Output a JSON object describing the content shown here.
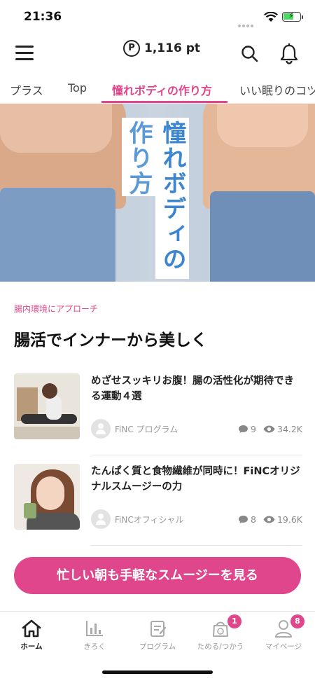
{
  "status_bar": {
    "time": "21:36"
  },
  "header": {
    "points_icon": "P",
    "points": "1,116 pt",
    "icons": [
      "menu-icon",
      "search-icon",
      "bell-icon"
    ]
  },
  "tabs": [
    {
      "label": "プラス"
    },
    {
      "label": "Top"
    },
    {
      "label": "憧れボディの作り方",
      "active": true
    },
    {
      "label": "いい眠りのコツ"
    }
  ],
  "hero": {
    "title_line1": "作り方",
    "title_line2": "憧れボディの"
  },
  "section": {
    "category": "腸内環境にアプローチ",
    "title": "腸活でインナーから美しく"
  },
  "articles": [
    {
      "headline": "めざせスッキリお腹！腸の活性化が期待できる運動４選",
      "author": "FiNC プログラム",
      "comments": "9",
      "views": "34.2K"
    },
    {
      "headline": "たんぱく質と食物繊維が同時に！FiNCオリジナルスムージーの力",
      "author": "FiNCオフィシャル",
      "comments": "8",
      "views": "19.6K"
    }
  ],
  "cta": {
    "label": "忙しい朝も手軽なスムージーを見る"
  },
  "bottom_nav": [
    {
      "label": "ホーム",
      "icon": "home-icon",
      "active": true
    },
    {
      "label": "きろく",
      "icon": "chart-icon"
    },
    {
      "label": "プログラム",
      "icon": "program-icon"
    },
    {
      "label": "ためる/つかう",
      "icon": "points-bag-icon",
      "badge": "1"
    },
    {
      "label": "マイページ",
      "icon": "profile-icon",
      "badge": "8"
    }
  ],
  "colors": {
    "accent": "#e0468b",
    "hero_title": "#3c85d0"
  }
}
